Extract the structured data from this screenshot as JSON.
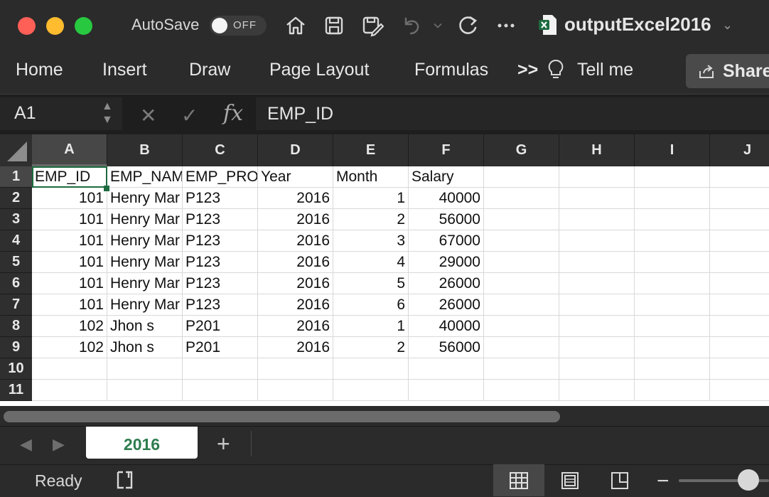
{
  "titlebar": {
    "autosave_label": "AutoSave",
    "autosave_state": "OFF",
    "document_title": "outputExcel2016"
  },
  "ribbon": {
    "tabs": [
      "Home",
      "Insert",
      "Draw",
      "Page Layout",
      "Formulas"
    ],
    "overflow": ">>",
    "tell_me": "Tell me",
    "share": "Share"
  },
  "formula_bar": {
    "name_box": "A1",
    "content": "EMP_ID"
  },
  "grid": {
    "columns": [
      "A",
      "B",
      "C",
      "D",
      "E",
      "F",
      "G",
      "H",
      "I",
      "J"
    ],
    "rows": [
      "1",
      "2",
      "3",
      "4",
      "5",
      "6",
      "7",
      "8",
      "9",
      "10",
      "11"
    ],
    "cells": [
      [
        "EMP_ID",
        "EMP_NAME",
        "EMP_PROJECT",
        "Year",
        "Month",
        "Salary"
      ],
      [
        "101",
        "Henry Mar",
        "P123",
        "2016",
        "1",
        "40000"
      ],
      [
        "101",
        "Henry Mar",
        "P123",
        "2016",
        "2",
        "56000"
      ],
      [
        "101",
        "Henry Mar",
        "P123",
        "2016",
        "3",
        "67000"
      ],
      [
        "101",
        "Henry Mar",
        "P123",
        "2016",
        "4",
        "29000"
      ],
      [
        "101",
        "Henry Mar",
        "P123",
        "2016",
        "5",
        "26000"
      ],
      [
        "101",
        "Henry Mar",
        "P123",
        "2016",
        "6",
        "26000"
      ],
      [
        "102",
        "Jhon s",
        "P201",
        "2016",
        "1",
        "40000"
      ],
      [
        "102",
        "Jhon s",
        "P201",
        "2016",
        "2",
        "56000"
      ]
    ]
  },
  "sheets": {
    "tabs": [
      "2016"
    ],
    "add": "+"
  },
  "status": {
    "ready": "Ready"
  }
}
